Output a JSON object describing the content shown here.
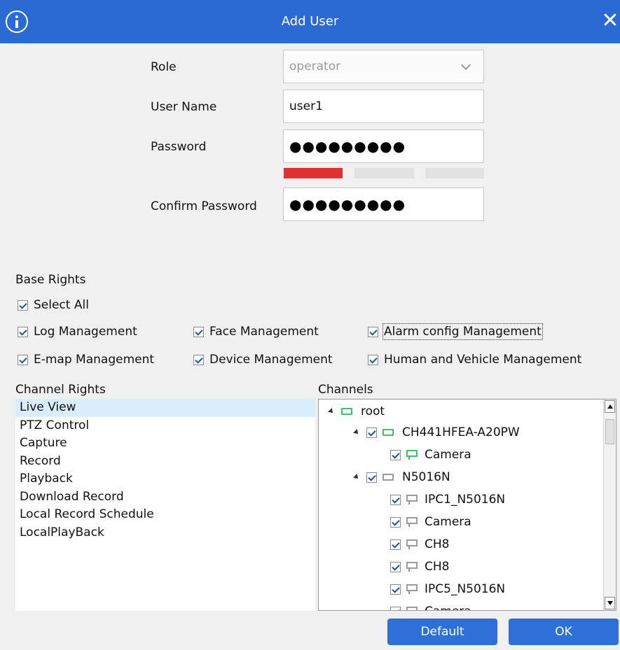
{
  "window": {
    "title": "Add User",
    "close_symbol": "✕"
  },
  "form": {
    "role_label": "Role",
    "role_value": "operator",
    "username_label": "User Name",
    "username_value": "user1",
    "password_label": "Password",
    "password_mask": "●●●●●●●●●",
    "confirm_label": "Confirm Password",
    "confirm_mask": "●●●●●●●●●",
    "strength_level": 1,
    "strength_color": "#e03030"
  },
  "base_rights": {
    "title": "Base Rights",
    "select_all": "Select All",
    "items": [
      "Log Management",
      "Face Management",
      "Alarm config Management",
      "E-map Management",
      "Device Management",
      "Human and Vehicle Management"
    ]
  },
  "channel_rights": {
    "title": "Channel Rights",
    "items": [
      "Live View",
      "PTZ Control",
      "Capture",
      "Record",
      "Playback",
      "Download Record",
      "Local Record Schedule",
      "LocalPlayBack"
    ],
    "selected_index": 0
  },
  "channels": {
    "title": "Channels",
    "root": "root",
    "devices": [
      {
        "name": "CH441HFEA-A20PW",
        "icon": "device-online-icon",
        "cameras": [
          "Camera"
        ]
      },
      {
        "name": "N5016N",
        "icon": "device-offline-icon",
        "cameras": [
          "IPC1_N5016N",
          "Camera",
          "CH8",
          "CH8",
          "IPC5_N5016N",
          "Camera"
        ]
      }
    ]
  },
  "buttons": {
    "default": "Default",
    "ok": "OK"
  },
  "colors": {
    "title_bar": "#2a6ad2",
    "button": "#2f6fd8",
    "online": "#3fbf6a",
    "selection": "#d9eefc"
  }
}
